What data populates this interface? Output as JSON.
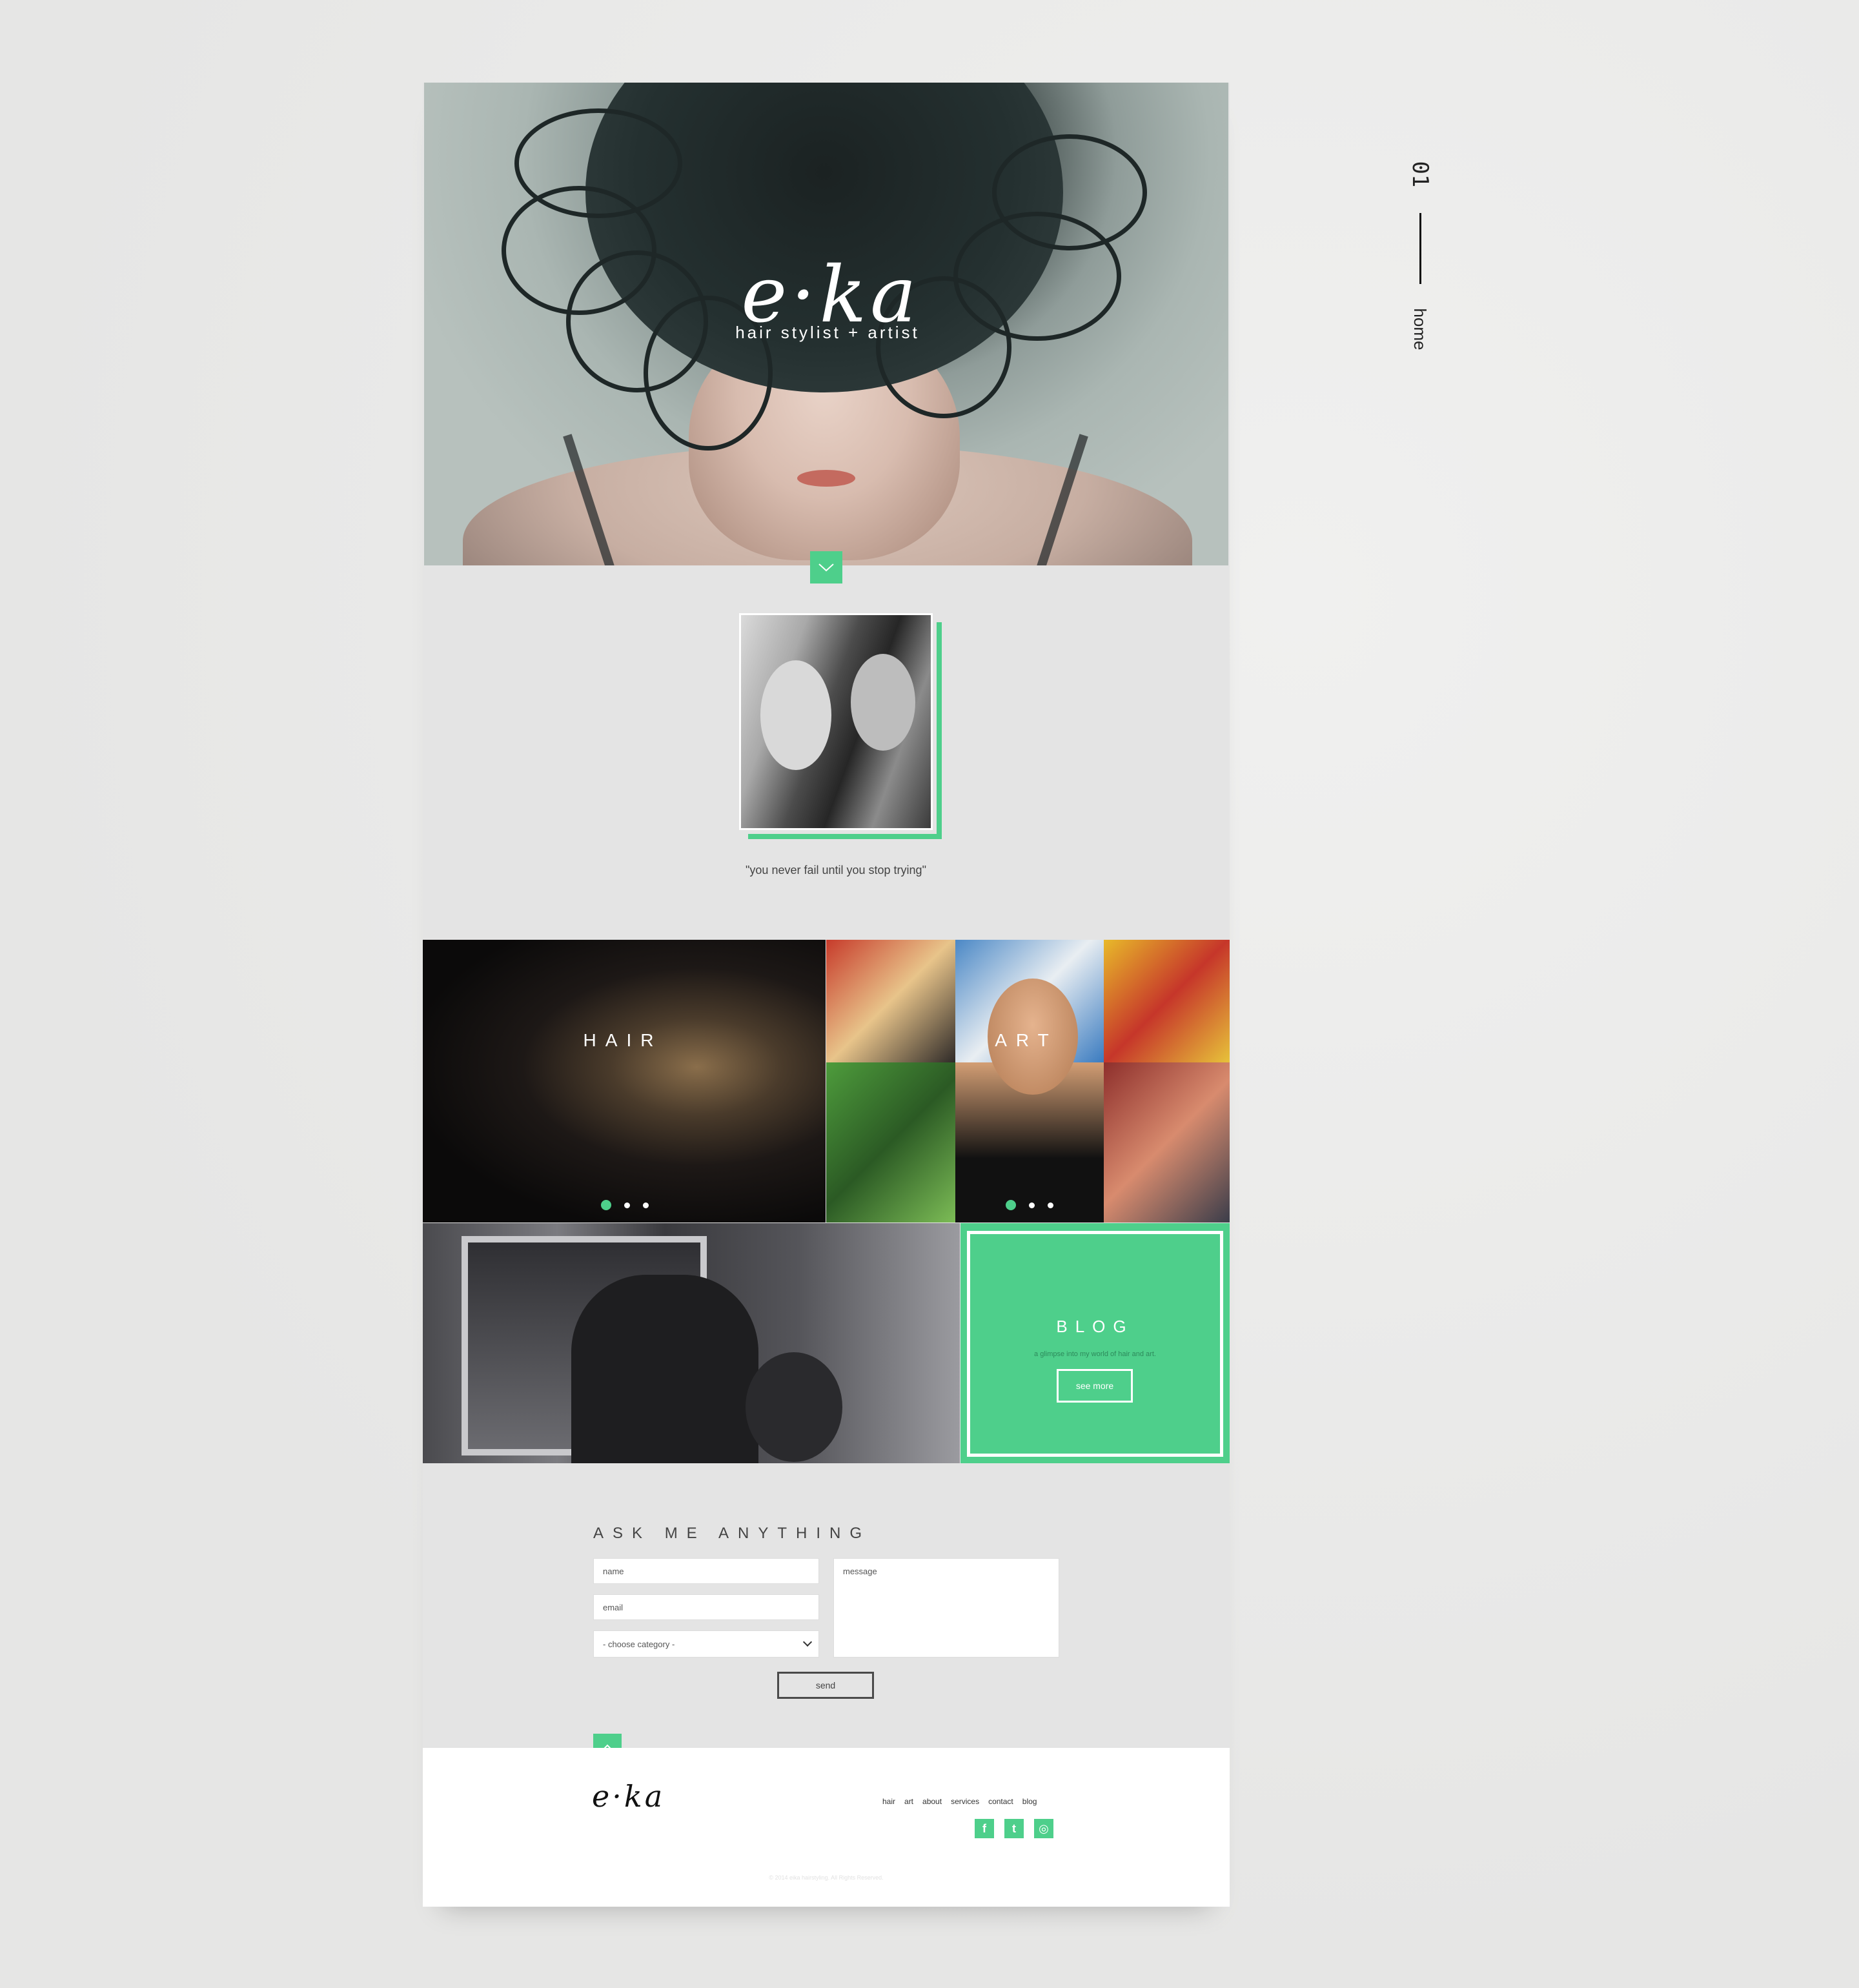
{
  "side_marker": {
    "number": "01",
    "label": "home"
  },
  "hero": {
    "logo": "e·ka",
    "tagline": "hair stylist + artist"
  },
  "about": {
    "quote": "\"you never fail until you stop trying\""
  },
  "tiles": {
    "hair_label": "HAIR",
    "art_label": "ART",
    "blog": {
      "title": "BLOG",
      "subtitle": "a glimpse into my world of hair and art.",
      "button": "see more"
    }
  },
  "contact": {
    "title": "ASK ME ANYTHING",
    "name_placeholder": "name",
    "email_placeholder": "email",
    "category_selected": "- choose category -",
    "message_placeholder": "message",
    "send": "send"
  },
  "footer": {
    "logo": "e·ka",
    "nav": [
      "hair",
      "art",
      "about",
      "services",
      "contact",
      "blog"
    ],
    "social": [
      {
        "icon": "facebook-icon",
        "glyph": "f"
      },
      {
        "icon": "twitter-icon",
        "glyph": "t"
      },
      {
        "icon": "instagram-icon",
        "glyph": "◎"
      }
    ],
    "copyright": "© 2014 eika hairstyling. All Rights Reserved."
  },
  "colors": {
    "accent": "#4ecf8b",
    "page_bg": "#e4e4e4",
    "footer_bg": "#ffffff"
  }
}
